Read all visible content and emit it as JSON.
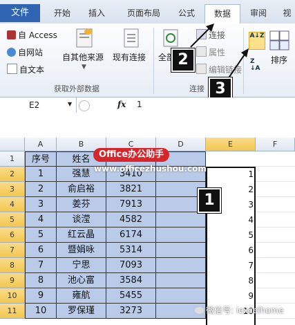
{
  "ribbon_tabs": [
    {
      "label": "文件",
      "active": false
    },
    {
      "label": "开始",
      "active": false
    },
    {
      "label": "插入",
      "active": false
    },
    {
      "label": "页面布局",
      "active": false
    },
    {
      "label": "公式",
      "active": false
    },
    {
      "label": "数据",
      "active": true
    },
    {
      "label": "审阅",
      "active": false
    },
    {
      "label": "视",
      "active": false
    }
  ],
  "ribbon": {
    "from_access": "自 Access",
    "from_web": "自网站",
    "from_text": "自文本",
    "other_sources": "自其他来源",
    "existing_connections": "现有连接",
    "group_external": "获取外部数据",
    "refresh_all": "全部",
    "connections": "连接",
    "properties": "属性",
    "edit_links": "编辑链接",
    "group_connections": "连接",
    "sort_az_icon": "A↓Z",
    "sort_label": "排序"
  },
  "callouts": {
    "one": "1",
    "two": "2",
    "three": "3"
  },
  "formula_bar": {
    "name_box": "E2",
    "fx": "fx",
    "value": "1"
  },
  "columns": [
    "A",
    "B",
    "C",
    "D",
    "E",
    "F"
  ],
  "table": {
    "headers": [
      "序号",
      "姓名"
    ],
    "rows": [
      {
        "row": "1",
        "a": "序号",
        "b": "姓名",
        "c": "",
        "d": "",
        "e": ""
      },
      {
        "row": "2",
        "a": "1",
        "b": "强慧",
        "c": "3410",
        "d": "",
        "e": "1"
      },
      {
        "row": "3",
        "a": "2",
        "b": "俞启裕",
        "c": "3821",
        "d": "",
        "e": "2"
      },
      {
        "row": "4",
        "a": "3",
        "b": "姜芬",
        "c": "7913",
        "d": "",
        "e": "3"
      },
      {
        "row": "5",
        "a": "4",
        "b": "谈滢",
        "c": "4582",
        "d": "",
        "e": "4"
      },
      {
        "row": "6",
        "a": "5",
        "b": "红云晶",
        "c": "6174",
        "d": "",
        "e": "5"
      },
      {
        "row": "7",
        "a": "6",
        "b": "暨娟咏",
        "c": "5314",
        "d": "",
        "e": "6"
      },
      {
        "row": "8",
        "a": "7",
        "b": "宁思",
        "c": "7093",
        "d": "",
        "e": "7"
      },
      {
        "row": "9",
        "a": "8",
        "b": "池心富",
        "c": "3584",
        "d": "",
        "e": "8"
      },
      {
        "row": "10",
        "a": "9",
        "b": "雍航",
        "c": "5455",
        "d": "",
        "e": "9"
      },
      {
        "row": "11",
        "a": "10",
        "b": "罗保瑾",
        "c": "3273",
        "d": "",
        "e": "10"
      }
    ]
  },
  "watermark": {
    "badge": "Office办公助手",
    "url": "www.officezhushou.com"
  },
  "footer_watermark": "微信号: iexcelhome",
  "colors": {
    "file_tab": "#2e64b2",
    "selected_range": "#b9cbe8",
    "badge_red": "#d7262b"
  }
}
